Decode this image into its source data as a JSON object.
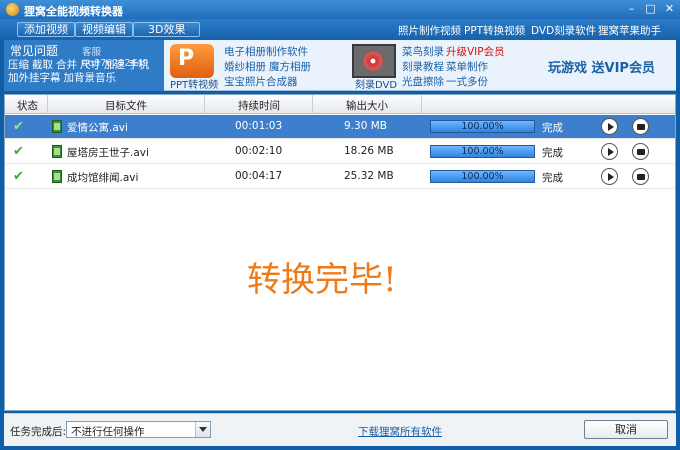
{
  "app": {
    "title": "狸窝全能视频转换器"
  },
  "window": {
    "min": "–",
    "max": "□",
    "close": "✕"
  },
  "toolbar": {
    "buttons": [
      "添加视频",
      "视频编辑",
      "3D效果"
    ],
    "links": [
      "照片制作视频",
      "PPT转换视频",
      "DVD刻录软件",
      "狸窝苹果助手"
    ]
  },
  "faq": {
    "title": "常见问题",
    "qq": "客服qq876292449",
    "links": [
      "压缩",
      "截取",
      "合并",
      "尺寸",
      "加速",
      "手机",
      "加外挂字幕",
      "加背景音乐"
    ]
  },
  "promo": {
    "ppt_caption": "PPT转视频",
    "ppt_links": [
      "电子相册制作软件",
      "婚纱相册",
      "魔方相册",
      "宝宝照片合成器"
    ],
    "dvd_caption": "刻录DVD",
    "dvd_links": [
      "菜鸟刻录",
      "升级VIP会员",
      "刻录教程",
      "菜单制作",
      "光盘擦除",
      "一式多份"
    ],
    "play_vip": "玩游戏 送VIP会员"
  },
  "table": {
    "headers": [
      "状态",
      "目标文件",
      "持续时间",
      "输出大小"
    ],
    "rows": [
      {
        "file": "爱情公寓.avi",
        "duration": "00:01:03",
        "size": "9.30 MB",
        "progress_text": "100.00%",
        "progress": 1.0,
        "state": "完成",
        "selected": true
      },
      {
        "file": "屋塔房王世子.avi",
        "duration": "00:02:10",
        "size": "18.26 MB",
        "progress_text": "100.00%",
        "progress": 1.0,
        "state": "完成",
        "selected": false
      },
      {
        "file": "成均馆绯闻.avi",
        "duration": "00:04:17",
        "size": "25.32 MB",
        "progress_text": "100.00%",
        "progress": 1.0,
        "state": "完成",
        "selected": false
      }
    ]
  },
  "status": {
    "done": "转换完毕!"
  },
  "bottom": {
    "label": "任务完成后:",
    "select_value": "不进行任何操作",
    "download_link": "下载狸窝所有软件",
    "cancel": "取消"
  },
  "colors": {
    "accent": "#1f6dbb",
    "selected_row": "#3d7fcc",
    "done_text": "#f07a18",
    "vip_red": "#d31414"
  }
}
